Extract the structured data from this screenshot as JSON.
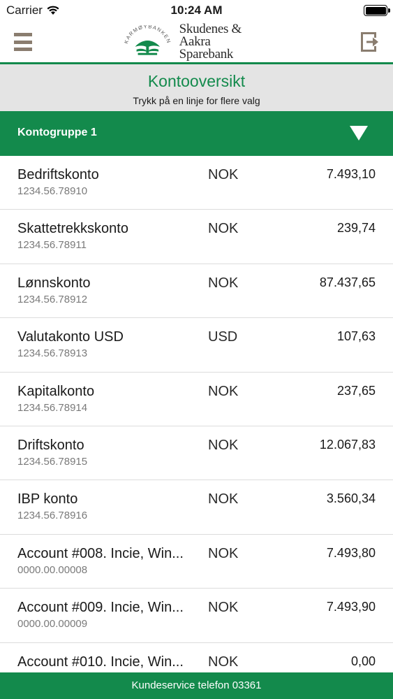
{
  "status_bar": {
    "carrier": "Carrier",
    "time": "10:24 AM"
  },
  "header": {
    "menu_icon": "hamburger-menu-icon",
    "logo_arc_text": "KARMØYBANKEN",
    "logo_line1": "Skudenes & Aakra",
    "logo_line2": "Sparebank",
    "logout_icon": "logout-icon"
  },
  "title_section": {
    "title": "Kontooversikt",
    "subtitle": "Trykk på en linje for flere valg"
  },
  "group": {
    "label": "Kontogruppe 1",
    "arrow_icon": "triangle-down-icon"
  },
  "accounts": [
    {
      "name": "Bedriftskonto",
      "number": "1234.56.78910",
      "currency": "NOK",
      "amount": "7.493,10"
    },
    {
      "name": "Skattetrekkskonto",
      "number": "1234.56.78911",
      "currency": "NOK",
      "amount": "239,74"
    },
    {
      "name": "Lønnskonto",
      "number": "1234.56.78912",
      "currency": "NOK",
      "amount": "87.437,65"
    },
    {
      "name": "Valutakonto USD",
      "number": "1234.56.78913",
      "currency": "USD",
      "amount": "107,63"
    },
    {
      "name": "Kapitalkonto",
      "number": "1234.56.78914",
      "currency": "NOK",
      "amount": "237,65"
    },
    {
      "name": "Driftskonto",
      "number": "1234.56.78915",
      "currency": "NOK",
      "amount": "12.067,83"
    },
    {
      "name": "IBP konto",
      "number": "1234.56.78916",
      "currency": "NOK",
      "amount": "3.560,34"
    },
    {
      "name": "Account #008. Incie, Win...",
      "number": "0000.00.00008",
      "currency": "NOK",
      "amount": "7.493,80"
    },
    {
      "name": "Account #009. Incie, Win...",
      "number": "0000.00.00009",
      "currency": "NOK",
      "amount": "7.493,90"
    },
    {
      "name": "Account #010. Incie, Win...",
      "number": "",
      "currency": "NOK",
      "amount": "0,00"
    }
  ],
  "footer": {
    "text": "Kundeservice telefon 03361"
  },
  "colors": {
    "brand_green": "#138a4c",
    "menu_brown": "#8a7d6f",
    "title_bg": "#e4e4e4"
  }
}
